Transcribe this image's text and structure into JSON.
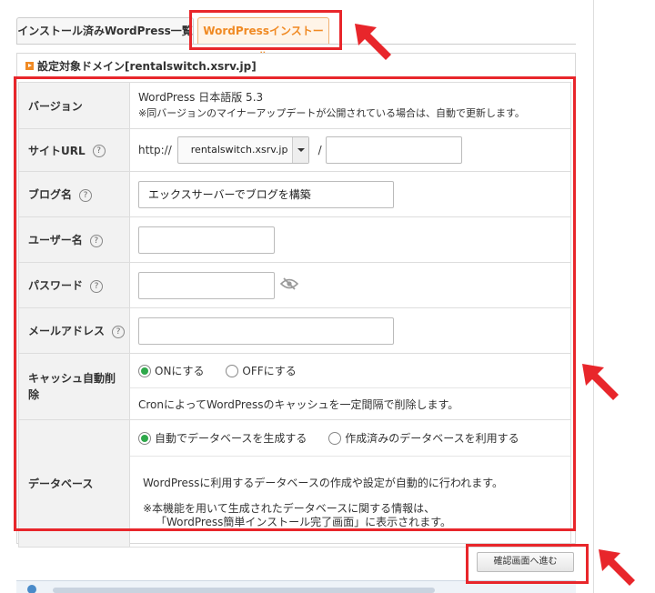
{
  "tabs": {
    "installed": "インストール済みWordPress一覧",
    "install": "WordPressインストール"
  },
  "domain_heading": "設定対象ドメイン[rentalswitch.xsrv.jp]",
  "form": {
    "version": {
      "label": "バージョン",
      "value": "WordPress 日本語版 5.3",
      "note": "※同バージョンのマイナーアップデートが公開されている場合は、自動で更新します。"
    },
    "site_url": {
      "label": "サイトURL",
      "prefix": "http://",
      "domain": "rentalswitch.xsrv.jp",
      "separator": "/",
      "path": ""
    },
    "blog_name": {
      "label": "ブログ名",
      "value": "エックスサーバーでブログを構築"
    },
    "user_name": {
      "label": "ユーザー名",
      "value": ""
    },
    "password": {
      "label": "パスワード",
      "value": ""
    },
    "email": {
      "label": "メールアドレス",
      "value": ""
    },
    "cache": {
      "label": "キャッシュ自動削除",
      "on": "ONにする",
      "off": "OFFにする",
      "selected": "on",
      "note": "CronによってWordPressのキャッシュを一定間隔で削除します。"
    },
    "database": {
      "label": "データベース",
      "auto": "自動でデータベースを生成する",
      "existing": "作成済みのデータベースを利用する",
      "selected": "auto",
      "note1": "WordPressに利用するデータベースの作成や設定が自動的に行われます。",
      "note2": "※本機能を用いて生成されたデータベースに関する情報は、",
      "note3": "「WordPress簡単インストール完了画面」に表示されます。"
    }
  },
  "help_glyph": "?",
  "confirm_button": "確認画面へ進む",
  "colors": {
    "highlight": "#e8262b",
    "accent": "#f08a24",
    "radio_on": "#2ea84a"
  },
  "icons": [
    "help-icon",
    "eye-slash-icon",
    "info-icon",
    "arrow-pointer-icon"
  ]
}
